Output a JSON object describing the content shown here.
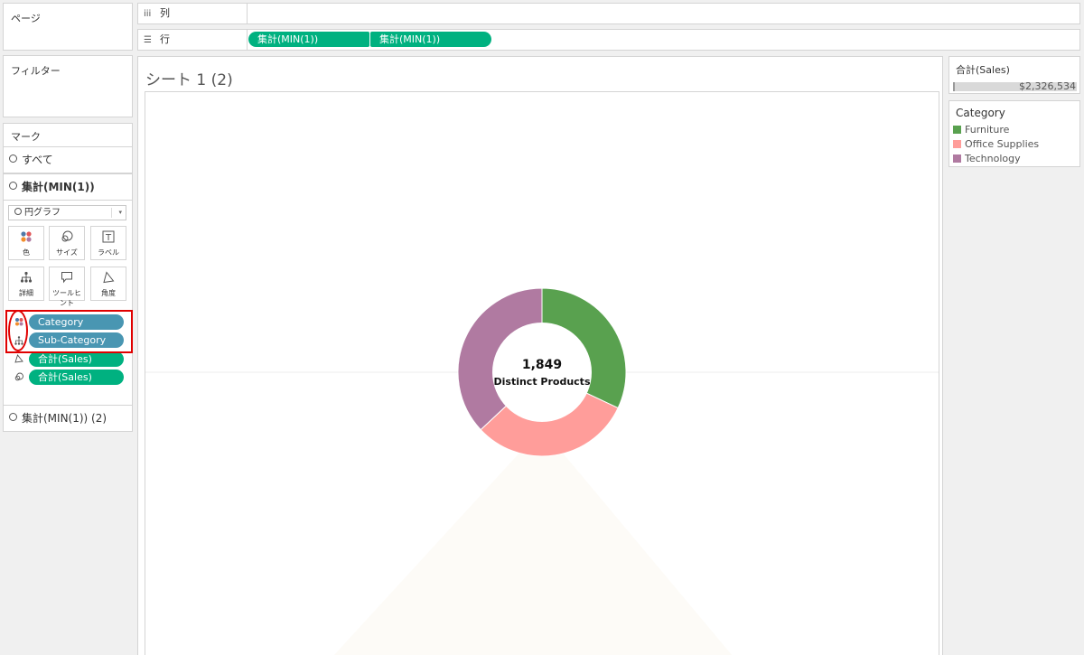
{
  "pages_panel": {
    "title": "ページ"
  },
  "filters_panel": {
    "title": "フィルター"
  },
  "marks_panel": {
    "title": "マーク",
    "all_label": "すべて",
    "layer1_label": "集計(MIN(1))",
    "mark_type": "円グラフ",
    "buttons": [
      {
        "label": "色",
        "icon": "color-dots-icon"
      },
      {
        "label": "サイズ",
        "icon": "size-icon"
      },
      {
        "label": "ラベル",
        "icon": "label-icon"
      },
      {
        "label": "詳細",
        "icon": "detail-icon"
      },
      {
        "label": "ツールヒント",
        "icon": "tooltip-icon"
      },
      {
        "label": "角度",
        "icon": "angle-icon"
      }
    ],
    "fields": [
      {
        "label": "Category",
        "role": "color"
      },
      {
        "label": "Sub-Category",
        "role": "detail"
      },
      {
        "label": "合計(Sales)",
        "role": "angle"
      },
      {
        "label": "合計(Sales)",
        "role": "size"
      }
    ],
    "layer2_label": "集計(MIN(1)) (2)"
  },
  "shelves": {
    "columns_label": "列",
    "rows_label": "行",
    "row_pills": [
      "集計(MIN(1))",
      "集計(MIN(1))"
    ]
  },
  "sheet": {
    "title": "シート 1 (2)"
  },
  "donut": {
    "value": "1,849",
    "caption": "Distinct Products"
  },
  "size_legend": {
    "title": "合計(Sales)",
    "value": "$2,326,534"
  },
  "color_legend": {
    "title": "Category",
    "items": [
      {
        "label": "Furniture",
        "color": "#59a14f"
      },
      {
        "label": "Office Supplies",
        "color": "#ff9d9a"
      },
      {
        "label": "Technology",
        "color": "#b07aa1"
      }
    ]
  },
  "chart_data": {
    "type": "pie",
    "categories": [
      "Furniture",
      "Office Supplies",
      "Technology"
    ],
    "values": [
      32,
      31,
      37
    ],
    "colors": [
      "#59a14f",
      "#ff9d9a",
      "#b07aa1"
    ]
  }
}
